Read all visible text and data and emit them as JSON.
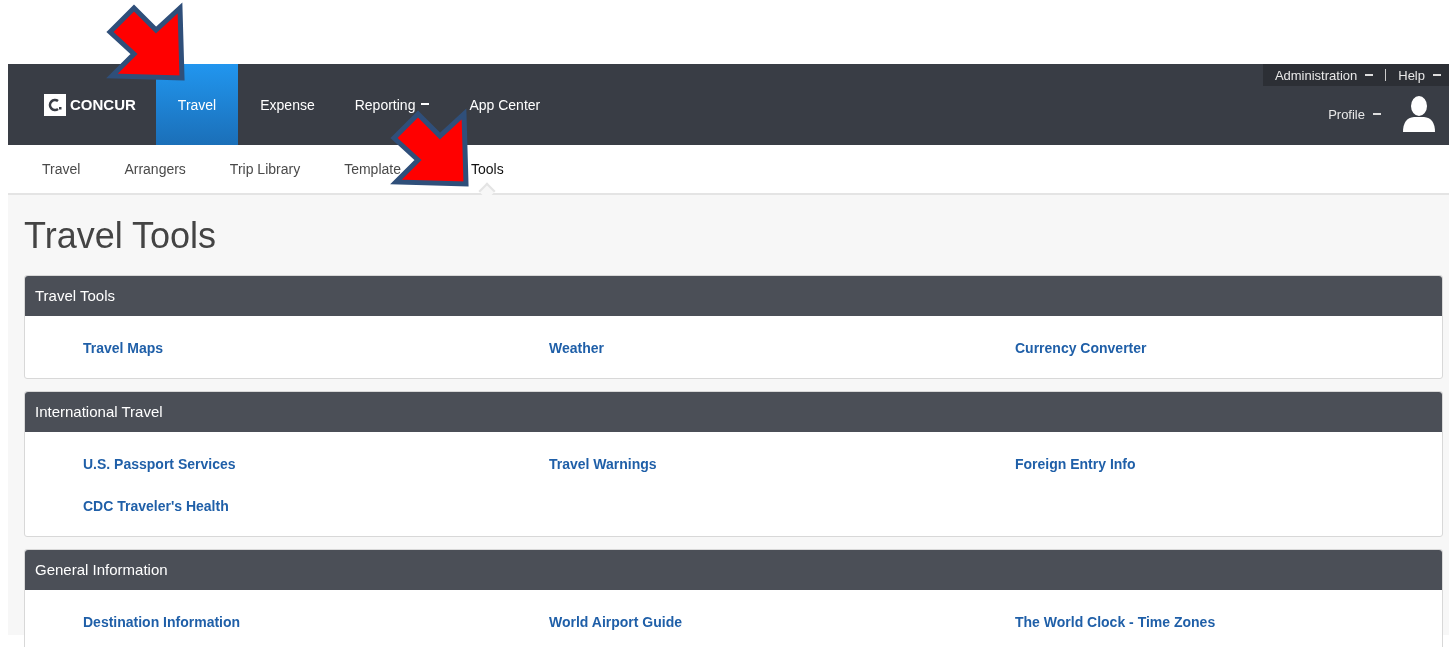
{
  "logo": {
    "text": "CONCUR"
  },
  "main_nav": [
    {
      "label": "Travel",
      "selected": true,
      "dropdown": false
    },
    {
      "label": "Expense",
      "selected": false,
      "dropdown": false
    },
    {
      "label": "Reporting",
      "selected": false,
      "dropdown": true
    },
    {
      "label": "App Center",
      "selected": false,
      "dropdown": false
    }
  ],
  "top_links": [
    {
      "label": "Administration"
    },
    {
      "label": "Help"
    }
  ],
  "profile": {
    "label": "Profile"
  },
  "sub_nav": [
    {
      "label": "Travel",
      "selected": false
    },
    {
      "label": "Arrangers",
      "selected": false
    },
    {
      "label": "Trip Library",
      "selected": false
    },
    {
      "label": "Template",
      "selected": false
    },
    {
      "label": "Tools",
      "selected": true
    }
  ],
  "page_title": "Travel Tools",
  "sections": [
    {
      "title": "Travel Tools",
      "links": [
        "Travel Maps",
        "Weather",
        "Currency Converter"
      ]
    },
    {
      "title": "International Travel",
      "links": [
        "U.S. Passport Services",
        "Travel Warnings",
        "Foreign Entry Info",
        "CDC Traveler's Health"
      ]
    },
    {
      "title": "General Information",
      "links": [
        "Destination Information",
        "World Airport Guide",
        "The World Clock - Time Zones"
      ]
    }
  ]
}
